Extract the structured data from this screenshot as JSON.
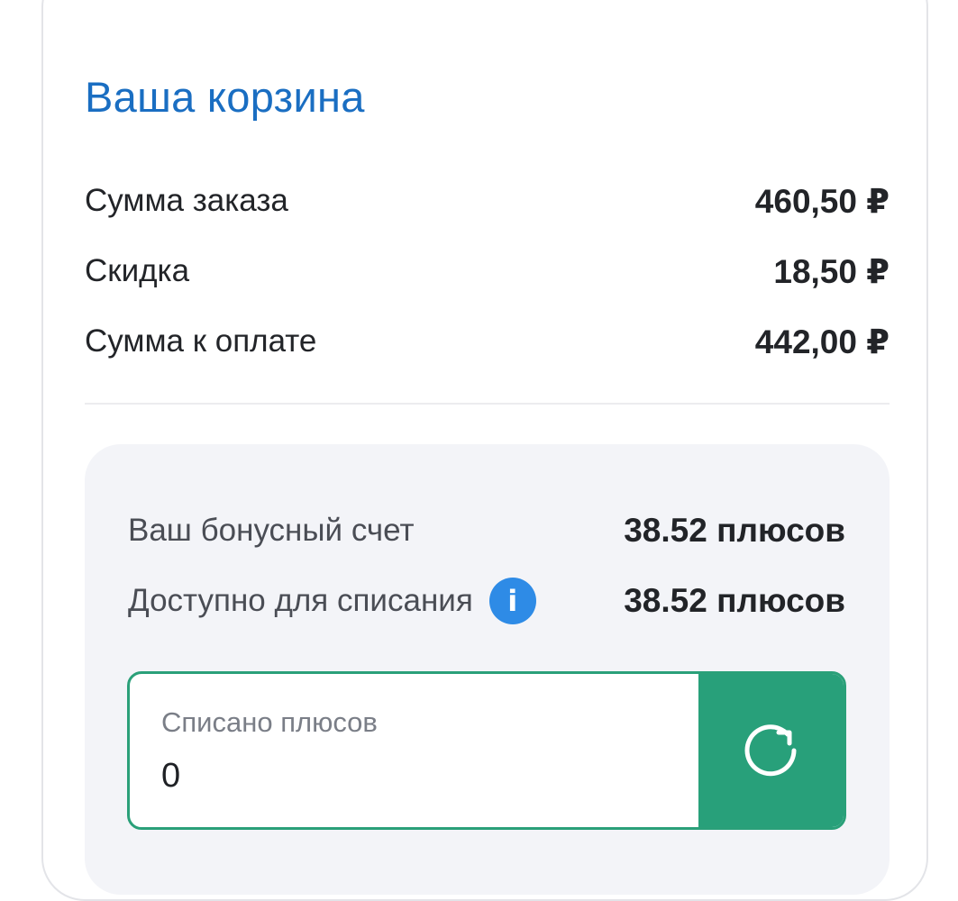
{
  "cart": {
    "title": "Ваша корзина",
    "order_sum_label": "Сумма заказа",
    "order_sum_value": "460,50 ₽",
    "discount_label": "Скидка",
    "discount_value": "18,50 ₽",
    "to_pay_label": "Сумма к оплате",
    "to_pay_value": "442,00 ₽"
  },
  "bonus": {
    "account_label": "Ваш бонусный счет",
    "account_value": "38.52 плюсов",
    "available_label": "Доступно для списания",
    "available_value": "38.52 плюсов",
    "info_icon": "info-icon",
    "info_glyph": "i",
    "input_label": "Списано плюсов",
    "input_value": "0",
    "refresh_icon": "refresh-icon"
  },
  "colors": {
    "accent_title": "#1a6ec2",
    "accent_green": "#28a07a",
    "info_blue": "#2e8be6"
  }
}
